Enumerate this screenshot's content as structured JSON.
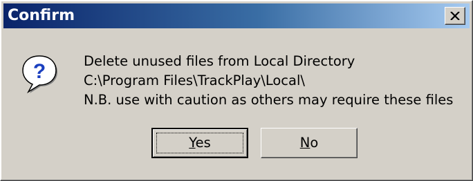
{
  "dialog": {
    "title": "Confirm",
    "close_icon": "close-icon",
    "message_icon": "question-icon",
    "message_lines": [
      "Delete unused files from Local Directory",
      "C:\\Program Files\\TrackPlay\\Local\\",
      "N.B. use with caution as others may require these files"
    ],
    "buttons": {
      "yes": {
        "mnemonic": "Y",
        "rest": "es"
      },
      "no": {
        "mnemonic": "N",
        "rest": "o"
      }
    }
  },
  "colors": {
    "titlebar_start": "#0a246a",
    "titlebar_end": "#a6caf0",
    "face": "#d4d0c8",
    "icon_blue": "#1a3fbf"
  }
}
